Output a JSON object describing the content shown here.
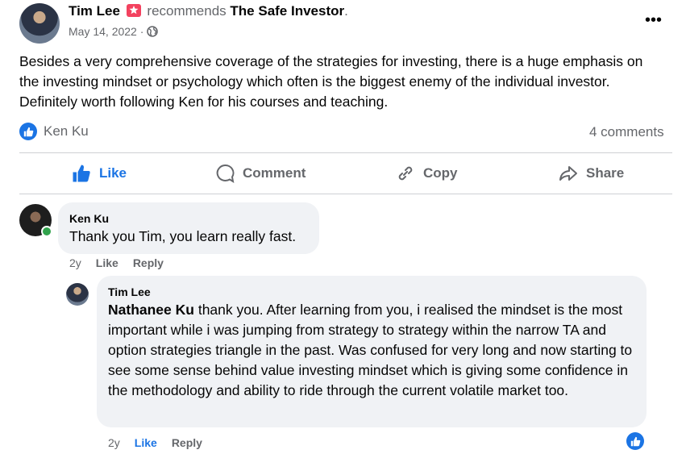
{
  "post": {
    "author": "Tim Lee",
    "recommends_text": "recommends",
    "page_name": "The Safe Investor",
    "period": ".",
    "date": "May 14, 2022",
    "separator": "·",
    "more_icon": "•••",
    "body": "Besides a very comprehensive coverage of the strategies for investing, there is a huge emphasis on the investing mindset or psychology which often is the biggest enemy of the individual investor. Definitely worth following Ken for his courses and teaching.",
    "reaction_name": "Ken Ku",
    "comments_count": "4 comments"
  },
  "actions": {
    "like": "Like",
    "comment": "Comment",
    "copy": "Copy",
    "share": "Share"
  },
  "comments": [
    {
      "author": "Ken Ku",
      "text": "Thank you Tim, you learn really fast.",
      "time": "2y",
      "like": "Like",
      "reply": "Reply"
    },
    {
      "author": "Tim Lee",
      "mention": "Nathanee Ku",
      "text": " thank you. After learning from you, i realised the mindset is the most important while i was jumping from strategy to strategy within the narrow TA and option strategies triangle in the past. Was confused for very long and now starting to see some sense behind value investing mindset which is giving some confidence in the methodology and ability to ride through the current volatile market too.",
      "time": "2y",
      "like": "Like",
      "reply": "Reply"
    }
  ],
  "colors": {
    "accent": "#1b74e4",
    "muted": "#65676b",
    "bubble": "#f0f2f5",
    "badge": "#f3425f",
    "online": "#31a24c"
  }
}
